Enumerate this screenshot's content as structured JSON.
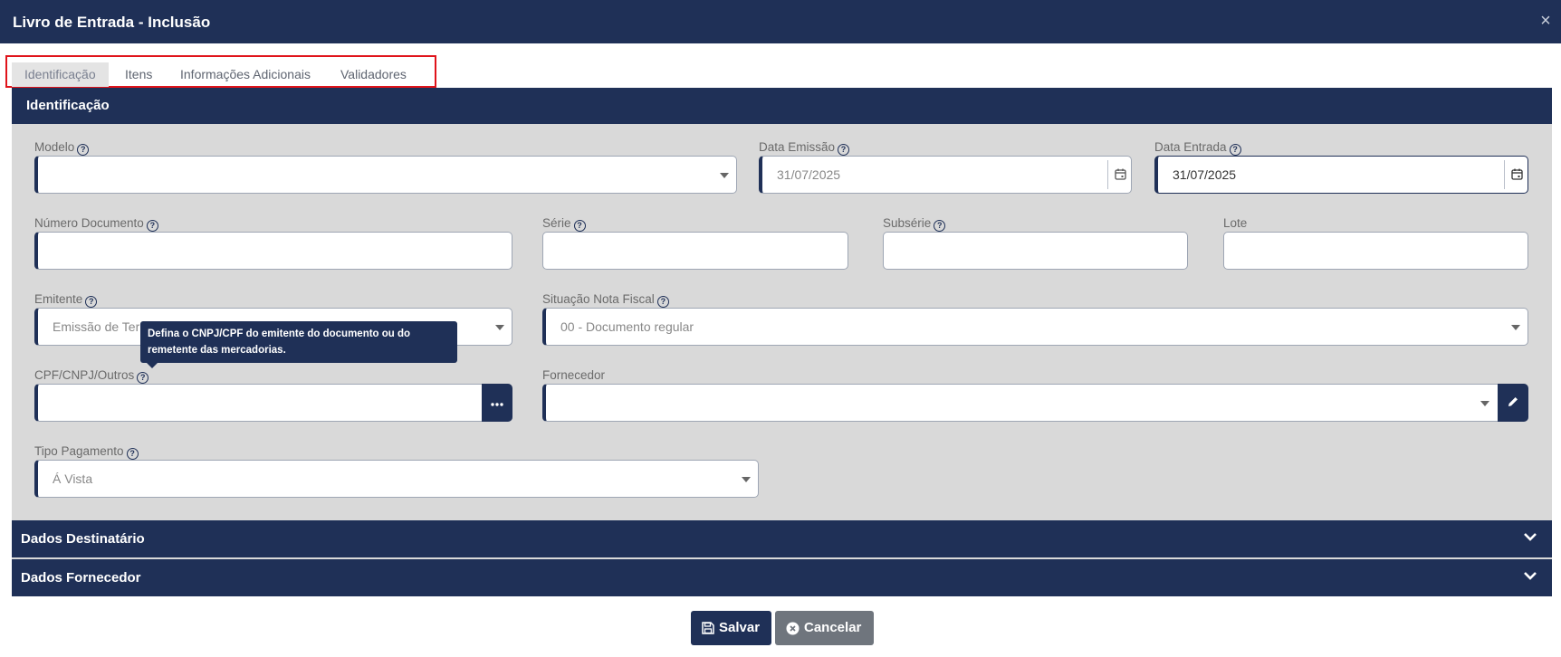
{
  "window": {
    "title": "Livro de Entrada - Inclusão",
    "close_symbol": "×"
  },
  "tabs": [
    {
      "label": "Identificação"
    },
    {
      "label": "Itens"
    },
    {
      "label": "Informações Adicionais"
    },
    {
      "label": "Validadores"
    }
  ],
  "section": {
    "title": "Identificação"
  },
  "fields": {
    "modelo": {
      "label": "Modelo",
      "value": ""
    },
    "data_emissao": {
      "label": "Data Emissão",
      "value": "31/07/2025"
    },
    "data_entrada": {
      "label": "Data Entrada",
      "value": "31/07/2025"
    },
    "numero_documento": {
      "label": "Número Documento",
      "value": ""
    },
    "serie": {
      "label": "Série",
      "value": ""
    },
    "subserie": {
      "label": "Subsérie",
      "value": ""
    },
    "lote": {
      "label": "Lote",
      "value": ""
    },
    "emitente": {
      "label": "Emitente",
      "value": "Emissão de Ter"
    },
    "situacao": {
      "label": "Situação Nota Fiscal",
      "value": "00 - Documento regular"
    },
    "cpf": {
      "label": "CPF/CNPJ/Outros",
      "value": ""
    },
    "fornecedor": {
      "label": "Fornecedor",
      "value": ""
    },
    "tipo_pagamento": {
      "label": "Tipo Pagamento",
      "value": "Á Vista"
    }
  },
  "help_symbol": "?",
  "tooltip": {
    "text": "Defina o CNPJ/CPF do emitente do documento ou do remetente das mercadorias."
  },
  "collapsibles": [
    {
      "title": "Dados Destinatário"
    },
    {
      "title": "Dados Fornecedor"
    }
  ],
  "buttons": {
    "save": "Salvar",
    "cancel": "Cancelar"
  },
  "colors": {
    "primary": "#1f3057",
    "panel": "#d9d9d9",
    "cancel": "#6f757d",
    "highlight_box": "#e0141b"
  }
}
